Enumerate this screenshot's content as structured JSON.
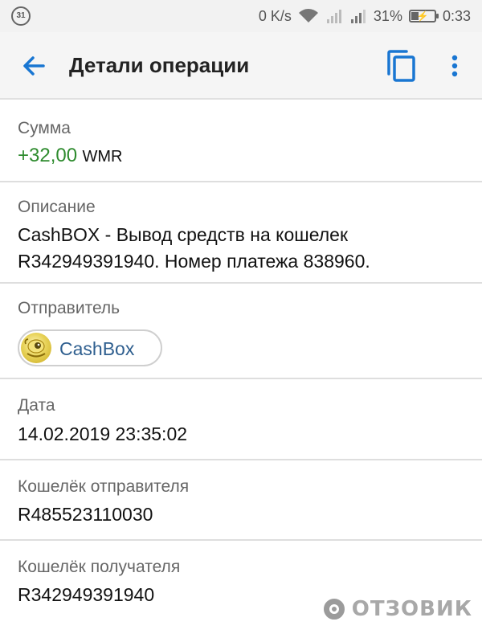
{
  "status_bar": {
    "calendar_badge": "31",
    "network_speed": "0 K/s",
    "battery_percent": "31%",
    "battery_level": 0.31,
    "time": "0:33",
    "icons": [
      "calendar-icon",
      "wifi-icon",
      "signal-icon",
      "signal-icon",
      "battery-charging-icon"
    ]
  },
  "app_bar": {
    "title": "Детали операции",
    "back_icon": "arrow-left-icon",
    "copy_icon": "copy-icon",
    "more_icon": "more-vert-icon",
    "accent_color": "#1976d2"
  },
  "details": {
    "amount": {
      "label": "Сумма",
      "value": "+32,00",
      "currency": "WMR",
      "color": "#2e8b2e"
    },
    "description": {
      "label": "Описание",
      "line1": "CashBOX - Вывод средств на кошелек",
      "line2": "R342949391940. Номер платежа 838960."
    },
    "sender": {
      "label": "Отправитель",
      "name": "CashBox",
      "avatar_icon": "cashbox-logo-icon"
    },
    "date": {
      "label": "Дата",
      "value": "14.02.2019 23:35:02"
    },
    "sender_wallet": {
      "label": "Кошелёк отправителя",
      "value": "R485523110030"
    },
    "recipient_wallet": {
      "label": "Кошелёк получателя",
      "value": "R342949391940"
    }
  },
  "watermark": {
    "text": "ОТЗОВИК"
  }
}
